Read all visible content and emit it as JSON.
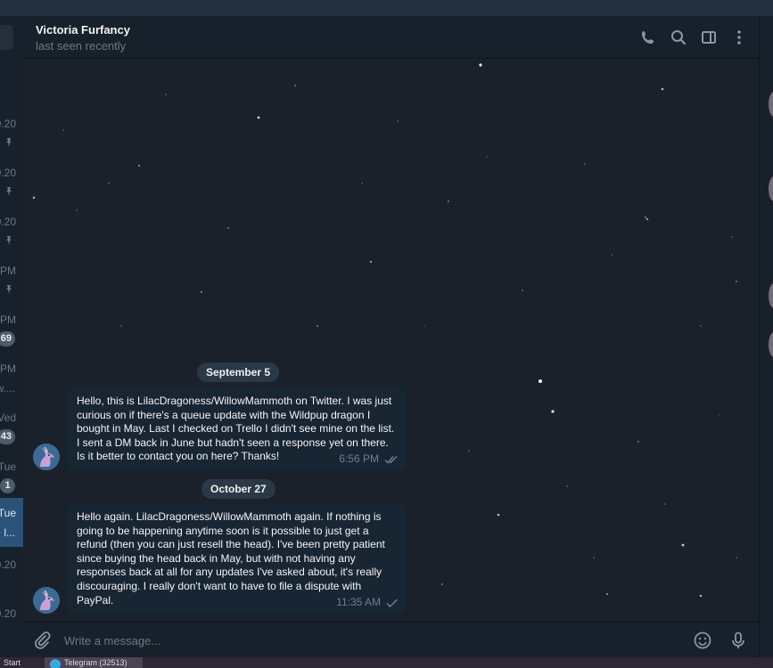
{
  "window": {
    "title": "Telegram"
  },
  "chatlist": {
    "rows": [
      {
        "time": "0.20",
        "pinned": true
      },
      {
        "time": "0.20",
        "pinned": true
      },
      {
        "time": "0.20",
        "pinned": true
      },
      {
        "time": "PM",
        "pinned": true
      },
      {
        "time": "PM",
        "badge": "69"
      },
      {
        "time": "PM",
        "snippet": "w...."
      },
      {
        "time": "Ved",
        "badge": "43"
      },
      {
        "time": "Tue",
        "badge": "1"
      },
      {
        "time": "Tue",
        "snippet": "l...",
        "active": true
      },
      {
        "time": "0.20"
      },
      {
        "time": "0.20"
      }
    ]
  },
  "header": {
    "name": "Victoria Furfancy",
    "status": "last seen recently",
    "icons": [
      "phone-icon",
      "search-icon",
      "sidebar-toggle-icon",
      "more-vertical-icon"
    ]
  },
  "messages": [
    {
      "date": "September 5",
      "text": "Hello, this is LilacDragoness/WillowMammoth on Twitter. I was just curious on if there's a queue update with the Wildpup dragon I bought in May. Last I checked on Trello I didn't see mine on the list. I sent a DM back in June but hadn't seen a response yet on there. Is it better to contact you on here? Thanks!",
      "time": "6:56 PM",
      "status": "read"
    },
    {
      "date": "October 27",
      "text": "Hello again. LilacDragoness/WillowMammoth again. If nothing is going to be happening anytime soon is it possible to just get a refund (then you can just resell the head). I've been pretty patient since buying the head back in May, but with not having any responses back at all for any updates I've asked about, it's really discouraging. I really don't want to have to file a dispute with PayPal.",
      "time": "11:35 AM",
      "status": "sent"
    }
  ],
  "composer": {
    "placeholder": "Write a message..."
  },
  "taskbar": {
    "start": "Start",
    "item_label": "Telegram (32513)"
  },
  "colors": {
    "bubble": "#182533",
    "accent": "#2b5278",
    "background": "#1b212b"
  }
}
